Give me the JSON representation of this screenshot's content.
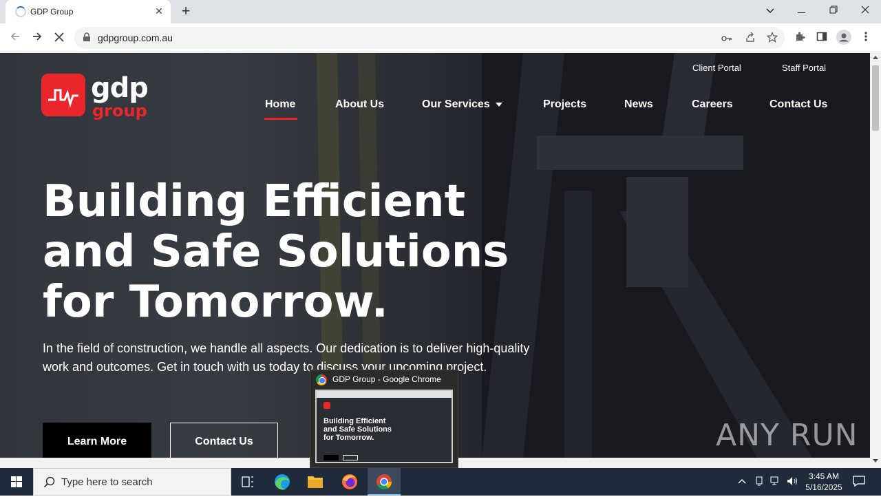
{
  "browser": {
    "tab_title": "GDP Group",
    "url": "gdpgroup.com.au"
  },
  "site": {
    "logo_top": "gdp",
    "logo_bottom": "group",
    "portals": [
      "Client Portal",
      "Staff Portal"
    ],
    "nav": [
      "Home",
      "About Us",
      "Our Services",
      "Projects",
      "News",
      "Careers",
      "Contact Us"
    ],
    "headline_lines": [
      "Building Efficient",
      "and Safe Solutions",
      "for Tomorrow."
    ],
    "subtext": "In the field of construction, we handle all aspects. Our dedication is to deliver high-quality work and outcomes. Get in touch with us today to discuss your upcoming project.",
    "buttons": {
      "primary": "Learn More",
      "secondary": "Contact Us"
    },
    "accent_color": "#e8262b"
  },
  "watermark": "ANY RUN",
  "preview": {
    "title": "GDP Group - Google Chrome",
    "headline_lines": [
      "Building Efficient",
      "and Safe Solutions",
      "for Tomorrow."
    ]
  },
  "taskbar": {
    "search_placeholder": "Type here to search",
    "time": "3:45 AM",
    "date": "5/16/2025"
  }
}
